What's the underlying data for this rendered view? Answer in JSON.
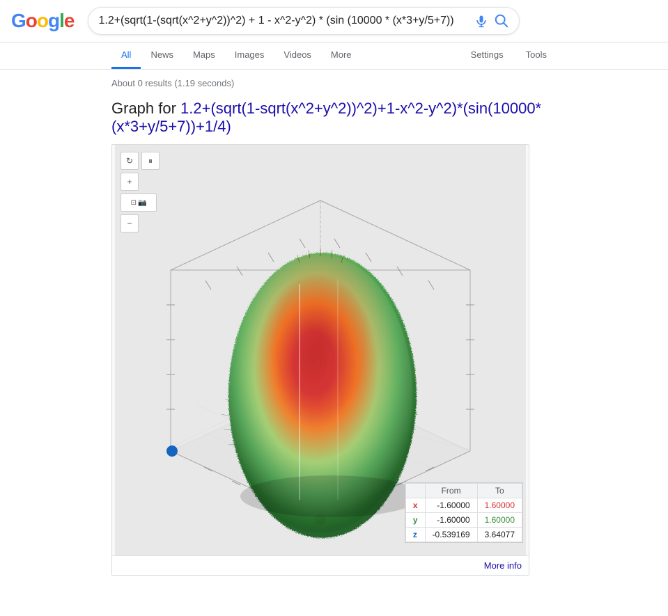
{
  "logo": {
    "letters": [
      "G",
      "o",
      "o",
      "g",
      "l",
      "e"
    ]
  },
  "search": {
    "query": "1.2+(sqrt(1-(sqrt(x^2+y^2))^2) + 1 - x^2-y^2) * (sin (10000 * (x*3+y/5+7))",
    "mic_label": "mic",
    "search_label": "search"
  },
  "nav": {
    "items": [
      {
        "label": "All",
        "active": true
      },
      {
        "label": "News",
        "active": false
      },
      {
        "label": "Maps",
        "active": false
      },
      {
        "label": "Images",
        "active": false
      },
      {
        "label": "Videos",
        "active": false
      },
      {
        "label": "More",
        "active": false
      }
    ],
    "right_items": [
      {
        "label": "Settings"
      },
      {
        "label": "Tools"
      }
    ]
  },
  "results": {
    "count_text": "About 0 results (1.19 seconds)",
    "graph_title_prefix": "Graph for ",
    "graph_formula": "1.2+(sqrt(1-sqrt(x^2+y^2))^2)+1-x^2-y^2)*(sin(10000*(x*3+y/5+7))+1/4)"
  },
  "graph_controls": {
    "rotate_icon": "↻",
    "pause_icon": "⏸",
    "plus_icon": "+",
    "fit_icon": "⊡",
    "camera_icon": "📷",
    "minus_icon": "−"
  },
  "range_table": {
    "headers": [
      "",
      "From",
      "To"
    ],
    "rows": [
      {
        "label": "x",
        "from": "-1.60000",
        "to": "1.60000",
        "label_class": "x-label",
        "from_class": "",
        "to_class": "val-red"
      },
      {
        "label": "y",
        "from": "-1.60000",
        "to": "1.60000",
        "label_class": "y-label",
        "from_class": "",
        "to_class": "val-green"
      },
      {
        "label": "z",
        "from": "-0.539169",
        "to": "3.64077",
        "label_class": "z-label",
        "from_class": "",
        "to_class": ""
      }
    ]
  },
  "more_info": {
    "label": "More info"
  }
}
